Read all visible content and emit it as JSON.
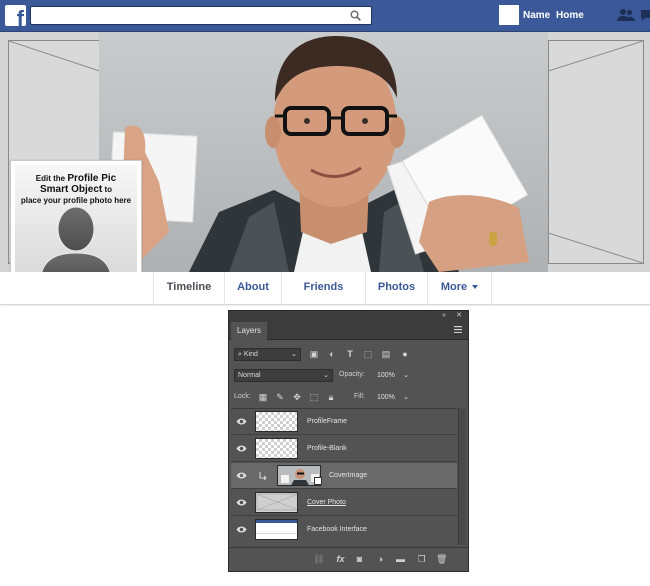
{
  "facebook": {
    "logo_letter": "f",
    "search": {
      "value": "",
      "placeholder": ""
    },
    "header": {
      "name_link": "Name",
      "home_link": "Home"
    },
    "profile_pic_text": {
      "line1_normal": "Edit the ",
      "line1_bold": "Profile Pic",
      "line2_bold": "Smart Object",
      "line2_normal": " to",
      "line3": "place your profile photo here"
    },
    "nav_tabs": [
      {
        "label": "Timeline",
        "active": true
      },
      {
        "label": "About"
      },
      {
        "label": "Friends"
      },
      {
        "label": "Photos"
      },
      {
        "label": "More"
      }
    ],
    "colors": {
      "brand_blue": "#3b5998",
      "nav_text": "#3b5998",
      "active_tab_text": "#4b4f56"
    }
  },
  "photoshop_panel": {
    "tab_label": "Layers",
    "filter_kind": "Kind",
    "blend_mode": "Normal",
    "opacity_label": "Opacity:",
    "opacity_value": "100%",
    "lock_label": "Lock:",
    "fill_label": "Fill:",
    "fill_value": "100%",
    "layers": [
      {
        "name": "ProfileFrame",
        "visible": true,
        "selected": false,
        "thumb": "transparent"
      },
      {
        "name": "Profile-Blank",
        "visible": true,
        "selected": false,
        "thumb": "transparent"
      },
      {
        "name": "CoverImage",
        "visible": true,
        "selected": true,
        "clipped": true,
        "smart_object": true,
        "thumb": "photo"
      },
      {
        "name": "Cover Photo",
        "visible": true,
        "selected": false,
        "underline": true,
        "thumb": "cover"
      },
      {
        "name": "Facebook Interface",
        "visible": true,
        "selected": false,
        "thumb": "interface"
      }
    ],
    "footer_icons": [
      "link-icon",
      "fx-icon",
      "mask-icon",
      "adjustment-icon",
      "folder-icon",
      "new-layer-icon",
      "trash-icon"
    ],
    "colors": {
      "panel_bg": "#535353",
      "selected_row": "#696969",
      "header_bg": "#3c3c3c"
    }
  }
}
